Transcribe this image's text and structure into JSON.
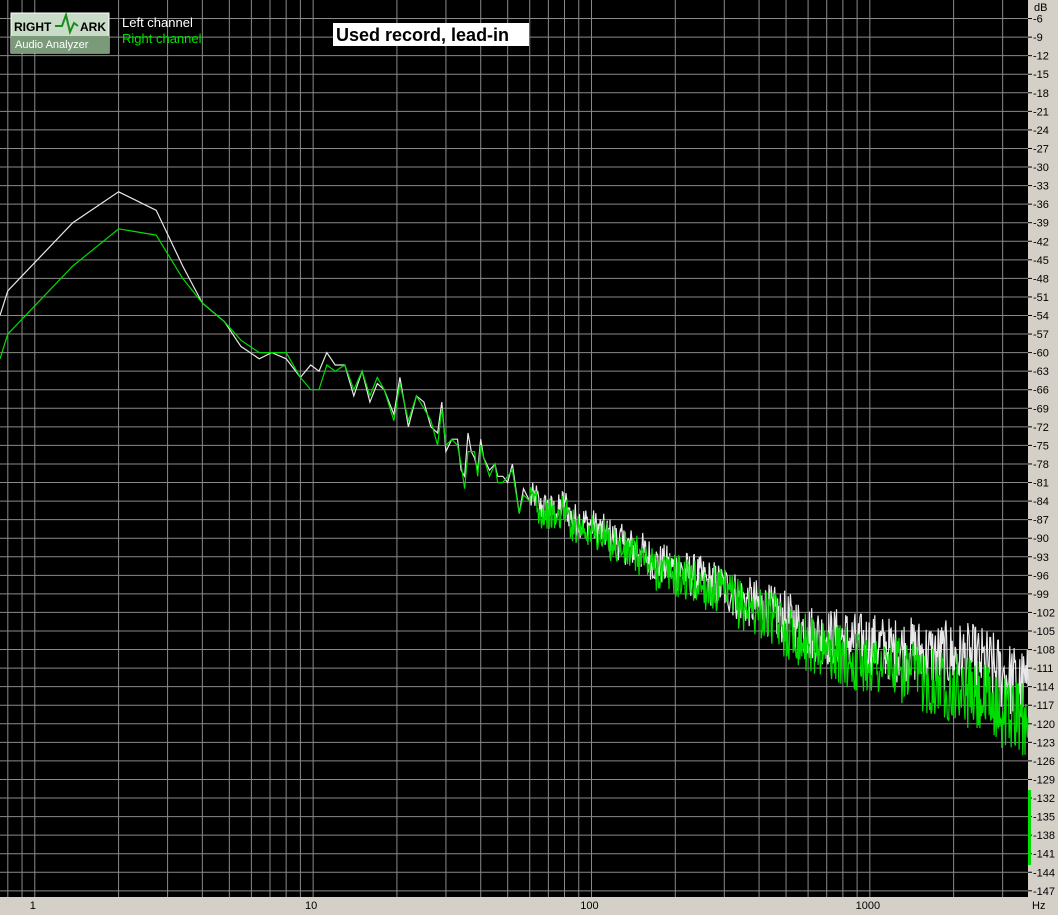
{
  "logo": {
    "word1": "RIGHT",
    "word2": "ARK",
    "subtitle": "Audio Analyzer"
  },
  "legend": [
    {
      "label": "Left channel",
      "color": "#ffffff"
    },
    {
      "label": "Right channel",
      "color": "#00e000"
    }
  ],
  "colors": {
    "plot_bg": "#000000",
    "grid": "#8a8a8a",
    "frame_bg": "#d4d0c8",
    "left": "#e8e8e8",
    "right": "#00dd00"
  },
  "chart_data": {
    "type": "line",
    "title": "Used record, lead-in",
    "xlabel": "Hz",
    "ylabel": "dB",
    "x_scale": "log",
    "xlim": [
      0.75,
      3700
    ],
    "ylim": [
      -148,
      -3
    ],
    "grid": true,
    "legend_position": "top-left",
    "x_tick_labels": [
      "1",
      "10",
      "100",
      "1000"
    ],
    "y_tick_labels": [
      "-6",
      "-9",
      "-12",
      "-15",
      "-18",
      "-21",
      "-24",
      "-27",
      "-30",
      "-33",
      "-36",
      "-39",
      "-42",
      "-45",
      "-48",
      "-51",
      "-54",
      "-57",
      "-60",
      "-63",
      "-66",
      "-69",
      "-72",
      "-75",
      "-78",
      "-81",
      "-84",
      "-87",
      "-90",
      "-93",
      "-96",
      "-99",
      "-102",
      "-105",
      "-108",
      "-111",
      "-114",
      "-117",
      "-120",
      "-123",
      "-126",
      "-129",
      "-132",
      "-135",
      "-138",
      "-141",
      "-144",
      "-147"
    ],
    "series": [
      {
        "name": "Left channel",
        "x": [
          0.75,
          0.8,
          1.37,
          2.0,
          2.73,
          3.4,
          4.0,
          4.8,
          5.5,
          6.4,
          7.1,
          8.0,
          9.0,
          9.8,
          10.5,
          11.2,
          12.0,
          13.0,
          14.0,
          15.0,
          16.0,
          17.0,
          18.0,
          19.5,
          20.5,
          22,
          23.5,
          25,
          26.5,
          28,
          29,
          30,
          31.5,
          33,
          34,
          35,
          36,
          37,
          38,
          39,
          40,
          41,
          43,
          45,
          46,
          48,
          50,
          52,
          55,
          57,
          60,
          63,
          65,
          70,
          75,
          80,
          85,
          90,
          100,
          110,
          120,
          130,
          150,
          170,
          200,
          230,
          260,
          300,
          350,
          400,
          450,
          500,
          550,
          600,
          700,
          800,
          900,
          1000,
          1200,
          1400,
          1700,
          2000,
          2500,
          3000,
          3500,
          3700
        ],
        "y": [
          -54,
          -50,
          -39,
          -34,
          -37,
          -46,
          -52,
          -55,
          -59,
          -61,
          -60,
          -61,
          -64,
          -62,
          -63,
          -60,
          -62,
          -62,
          -67,
          -63,
          -68,
          -65,
          -66,
          -70,
          -64,
          -72,
          -67,
          -68,
          -72,
          -73,
          -68,
          -76,
          -74,
          -74,
          -79,
          -80,
          -73,
          -76,
          -77,
          -79,
          -74,
          -77,
          -79,
          -78,
          -80,
          -80,
          -81,
          -78,
          -86,
          -82,
          -84,
          -83,
          -85,
          -85,
          -86,
          -84,
          -87,
          -87,
          -88,
          -89,
          -90,
          -91,
          -92,
          -94,
          -95,
          -96,
          -97,
          -98,
          -100,
          -101,
          -102,
          -103,
          -104,
          -105,
          -106,
          -106,
          -107,
          -107,
          -108,
          -108,
          -109,
          -109,
          -110,
          -112,
          -114,
          -114
        ]
      },
      {
        "name": "Right channel",
        "x": [
          0.75,
          0.8,
          1.37,
          2.0,
          2.73,
          3.4,
          4.0,
          4.8,
          5.5,
          6.4,
          7.1,
          8.0,
          9.0,
          9.8,
          10.5,
          11.2,
          12.0,
          13.0,
          14.0,
          15.0,
          16.0,
          17.0,
          18.0,
          19.5,
          20.5,
          22,
          23.5,
          25,
          26.5,
          28,
          29,
          30,
          31.5,
          33,
          34,
          35,
          36,
          37,
          38,
          39,
          40,
          41,
          43,
          45,
          46,
          48,
          50,
          52,
          55,
          57,
          60,
          63,
          65,
          70,
          75,
          80,
          85,
          90,
          100,
          110,
          120,
          130,
          150,
          170,
          200,
          230,
          260,
          300,
          350,
          400,
          450,
          500,
          550,
          600,
          700,
          800,
          900,
          1000,
          1200,
          1400,
          1700,
          2000,
          2500,
          3000,
          3500,
          3700
        ],
        "y": [
          -61,
          -57,
          -46,
          -40,
          -41,
          -48,
          -52,
          -55,
          -58,
          -60,
          -60,
          -60,
          -64,
          -66,
          -66,
          -62,
          -63,
          -62,
          -66,
          -63,
          -67,
          -64,
          -66,
          -71,
          -65,
          -71,
          -67,
          -69,
          -71,
          -75,
          -69,
          -75,
          -74,
          -75,
          -78,
          -82,
          -76,
          -76,
          -76,
          -80,
          -75,
          -77,
          -80,
          -78,
          -81,
          -81,
          -80,
          -79,
          -86,
          -83,
          -84,
          -83,
          -86,
          -86,
          -87,
          -85,
          -88,
          -88,
          -89,
          -90,
          -91,
          -92,
          -93,
          -95,
          -96,
          -97,
          -98,
          -99,
          -101,
          -102,
          -103,
          -105,
          -106,
          -107,
          -108,
          -109,
          -110,
          -110,
          -111,
          -112,
          -113,
          -114,
          -116,
          -118,
          -119,
          -119
        ]
      }
    ]
  }
}
